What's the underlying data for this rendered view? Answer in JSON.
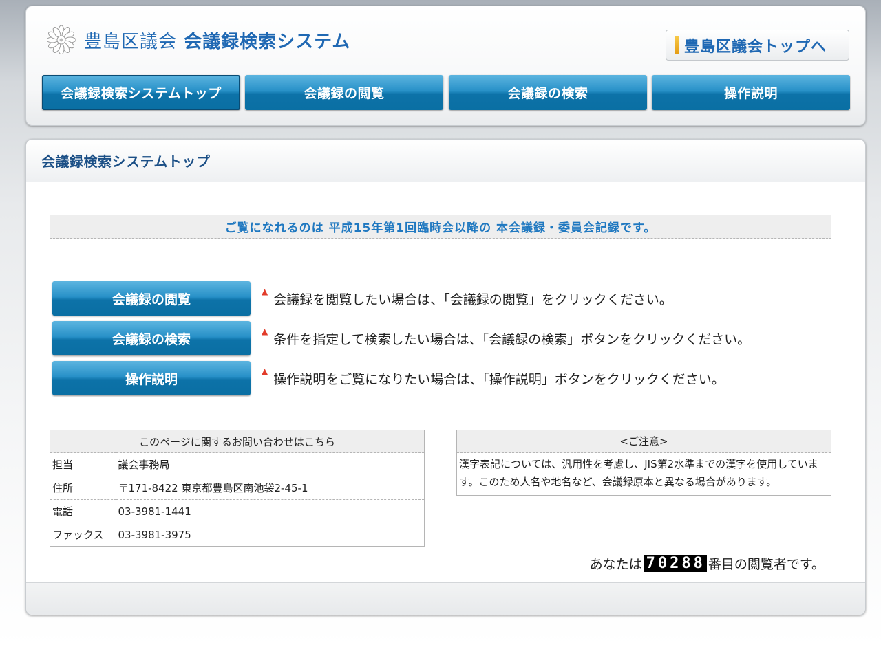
{
  "header": {
    "title_main": "豊島区議会",
    "title_sub": "会議録検索システム",
    "top_link_label": "豊島区議会トップへ"
  },
  "nav": [
    {
      "label": "会議録検索システムトップ"
    },
    {
      "label": "会議録の閲覧"
    },
    {
      "label": "会議録の検索"
    },
    {
      "label": "操作説明"
    }
  ],
  "main": {
    "heading": "会議録検索システムトップ",
    "notice": "ご覧になれるのは 平成15年第1回臨時会以降の 本会議録・委員会記録です。",
    "actions": [
      {
        "label": "会議録の閲覧",
        "desc": "会議録を閲覧したい場合は、「会議録の閲覧」をクリックください。"
      },
      {
        "label": "会議録の検索",
        "desc": "条件を指定して検索したい場合は、「会議録の検索」ボタンをクリックください。"
      },
      {
        "label": "操作説明",
        "desc": "操作説明をご覧になりたい場合は、「操作説明」ボタンをクリックください。"
      }
    ],
    "contact": {
      "heading": "このページに関するお問い合わせはこちら",
      "rows": [
        {
          "key": "担当",
          "value": "議会事務局"
        },
        {
          "key": "住所",
          "value": "〒171-8422 東京都豊島区南池袋2-45-1"
        },
        {
          "key": "電話",
          "value": "03-3981-1441"
        },
        {
          "key": "ファックス",
          "value": "03-3981-3975"
        }
      ]
    },
    "caution": {
      "heading": "<ご注意>",
      "body": "漢字表記については、汎用性を考慮し、JIS第2水準までの漢字を使用しています。このため人名や地名など、会議録原本と異なる場合があります。"
    },
    "counter": {
      "prefix": "あなたは",
      "digits": "70288",
      "suffix": "番目の閲覧者です。"
    }
  }
}
